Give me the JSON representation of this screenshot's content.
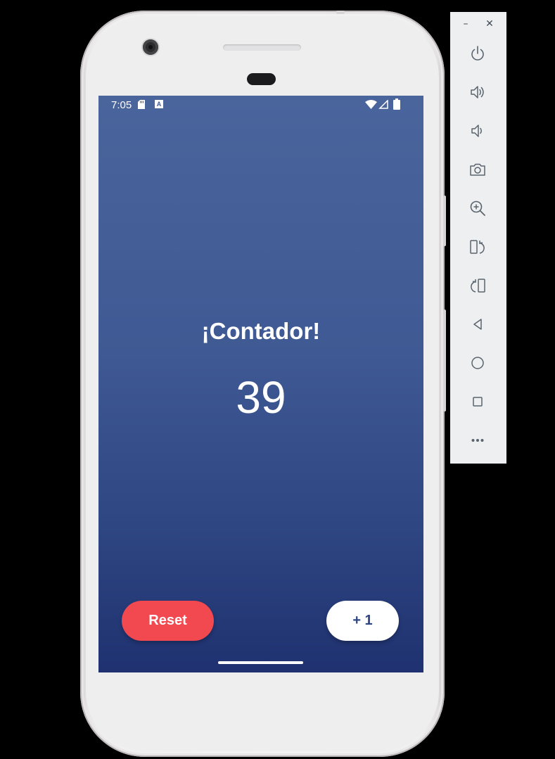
{
  "statusbar": {
    "time": "7:05",
    "badge_letter": "A"
  },
  "app": {
    "title": "¡Contador!",
    "count": "39",
    "reset_label": "Reset",
    "increment_label": "+ 1"
  },
  "colors": {
    "background_top": "#4a649c",
    "background_bottom": "#1f3170",
    "reset_button": "#f2484f",
    "increment_button": "#ffffff",
    "increment_text": "#2e4682"
  },
  "emulator_toolbar": {
    "minimize_glyph": "–",
    "close_glyph": "✕",
    "buttons": [
      "power-icon",
      "volume-up-icon",
      "volume-down-icon",
      "camera-icon",
      "zoom-in-icon",
      "rotate-left-icon",
      "rotate-right-icon",
      "back-icon",
      "home-icon",
      "overview-icon",
      "more-icon"
    ]
  }
}
